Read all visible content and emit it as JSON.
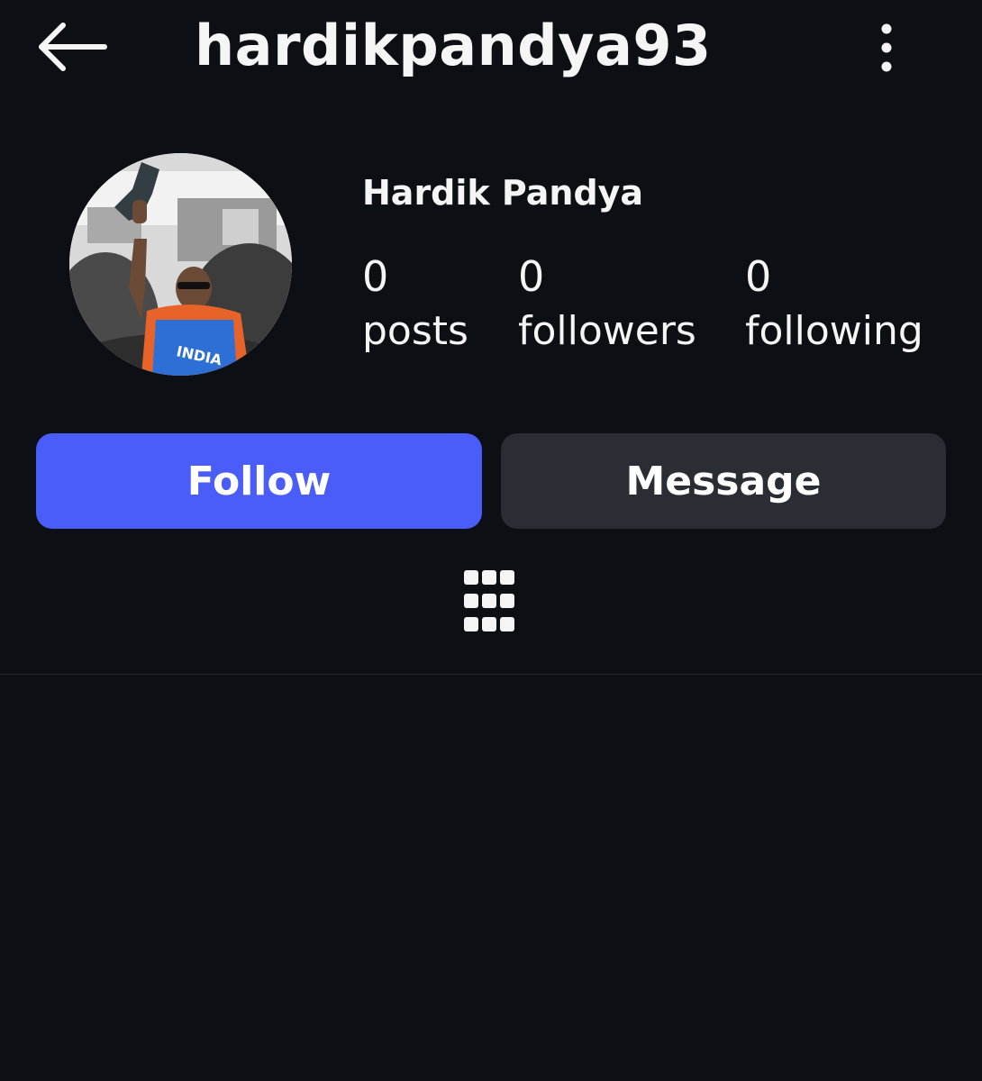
{
  "header": {
    "back_icon": "arrow-left-icon",
    "username": "hardikpandya93",
    "more_icon": "more-vertical-icon"
  },
  "profile": {
    "avatar": "profile-photo",
    "display_name": "Hardik Pandya",
    "stats": {
      "posts": {
        "count": "0",
        "label": "posts"
      },
      "followers": {
        "count": "0",
        "label": "followers"
      },
      "following": {
        "count": "0",
        "label": "following"
      }
    }
  },
  "actions": {
    "follow_label": "Follow",
    "message_label": "Message"
  },
  "tabs": {
    "grid_icon": "grid-icon"
  },
  "colors": {
    "background": "#0c1014",
    "follow_button": "#4a5df9",
    "message_button": "#2a2d33",
    "text": "#f5f5f5"
  }
}
